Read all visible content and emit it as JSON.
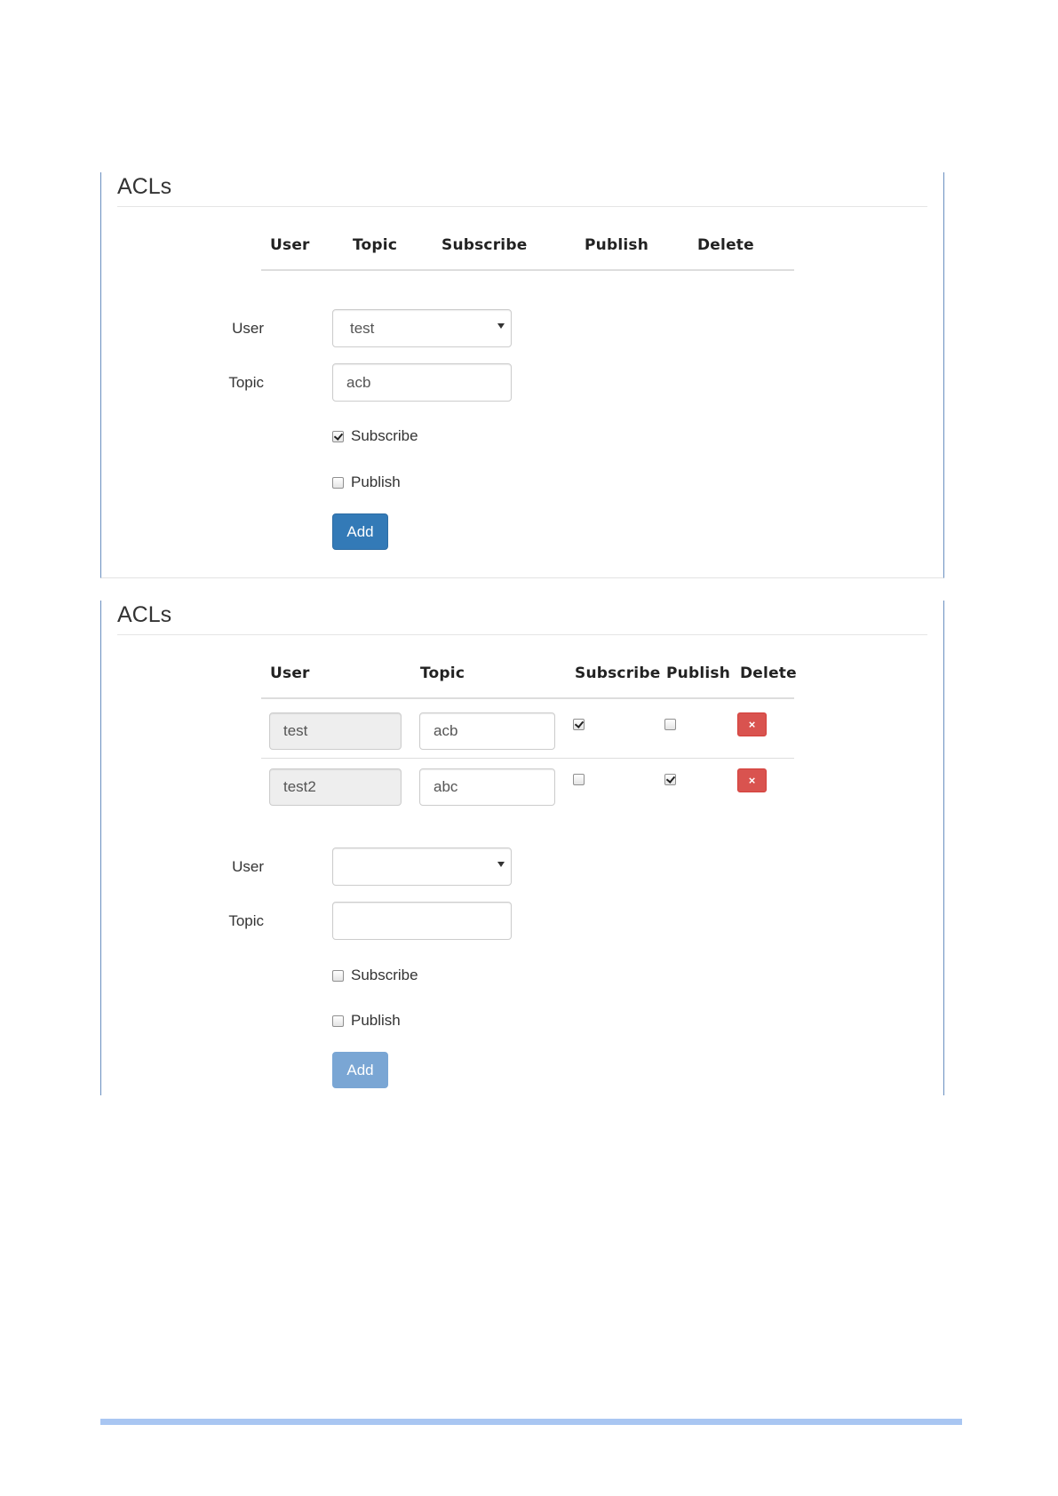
{
  "panel1": {
    "title": "ACLs",
    "headers": [
      "User",
      "Topic",
      "Subscribe",
      "Publish",
      "Delete"
    ],
    "form": {
      "user_label": "User",
      "user_value": "test",
      "topic_label": "Topic",
      "topic_value": "acb",
      "subscribe_label": "Subscribe",
      "subscribe_checked": true,
      "publish_label": "Publish",
      "publish_checked": false,
      "add_label": "Add"
    }
  },
  "panel2": {
    "title": "ACLs",
    "headers": [
      "User",
      "Topic",
      "Subscribe",
      "Publish",
      "Delete"
    ],
    "rows": [
      {
        "user": "test",
        "topic": "acb",
        "subscribe": true,
        "publish": false,
        "delete_icon": "×"
      },
      {
        "user": "test2",
        "topic": "abc",
        "subscribe": false,
        "publish": true,
        "delete_icon": "×"
      }
    ],
    "form": {
      "user_label": "User",
      "user_value": "",
      "topic_label": "Topic",
      "topic_value": "",
      "subscribe_label": "Subscribe",
      "subscribe_checked": false,
      "publish_label": "Publish",
      "publish_checked": false,
      "add_label": "Add",
      "add_disabled": true
    }
  },
  "colors": {
    "primary": "#337ab7",
    "primary_disabled": "#7aa6d4",
    "danger": "#d9534f",
    "panel_border": "#6a8fc0",
    "footer_bar": "#a9c6f2"
  }
}
